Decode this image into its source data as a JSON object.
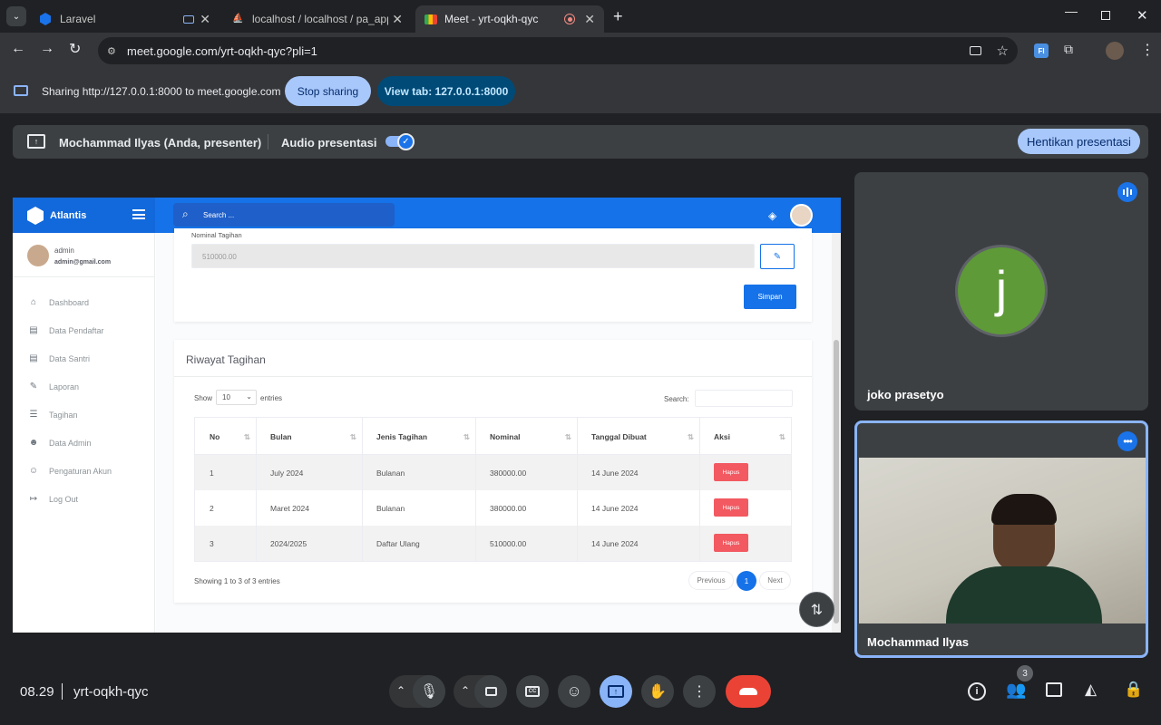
{
  "browser": {
    "tabs": [
      {
        "title": "Laravel"
      },
      {
        "title": "localhost / localhost / pa_apps"
      },
      {
        "title": "Meet - yrt-oqkh-qyc"
      }
    ],
    "url": "meet.google.com/yrt-oqkh-qyc?pli=1",
    "sharing_text": "Sharing http://127.0.0.1:8000 to meet.google.com",
    "stop_sharing": "Stop sharing",
    "view_tab": "View tab: 127.0.0.1:8000"
  },
  "meet": {
    "presenter": "Mochammad Ilyas (Anda, presenter)",
    "audio_label": "Audio presentasi",
    "stop_present": "Hentikan presentasi",
    "participants": [
      {
        "name": "joko prasetyo",
        "initial": "j"
      },
      {
        "name": "Mochammad Ilyas"
      }
    ],
    "time": "08.29",
    "meeting_code": "yrt-oqkh-qyc",
    "participant_count": "3",
    "colors": {
      "accent": "#8ab4f8",
      "end_call": "#ea4335",
      "avatar_green": "#5e9a37"
    }
  },
  "app": {
    "brand": "Atlantis",
    "search_placeholder": "Search ...",
    "user": {
      "name": "admin",
      "email": "admin@gmail.com"
    },
    "menu": [
      {
        "label": "Dashboard",
        "icon": "home-icon"
      },
      {
        "label": "Data Pendaftar",
        "icon": "id-card-icon"
      },
      {
        "label": "Data Santri",
        "icon": "id-card-icon"
      },
      {
        "label": "Laporan",
        "icon": "edit-icon"
      },
      {
        "label": "Tagihan",
        "icon": "database-icon"
      },
      {
        "label": "Data Admin",
        "icon": "users-icon"
      },
      {
        "label": "Pengaturan Akun",
        "icon": "user-cog-icon"
      },
      {
        "label": "Log Out",
        "icon": "sign-out-icon"
      }
    ],
    "form": {
      "label": "Nominal Tagihan",
      "value": "510000.00",
      "save": "Simpan"
    },
    "history": {
      "title": "Riwayat Tagihan",
      "show": "Show",
      "page_size": "10",
      "entries": "entries",
      "search_label": "Search:",
      "columns": [
        "No",
        "Bulan",
        "Jenis Tagihan",
        "Nominal",
        "Tanggal Dibuat",
        "Aksi"
      ],
      "rows": [
        {
          "no": "1",
          "bulan": "July 2024",
          "jenis": "Bulanan",
          "nominal": "380000.00",
          "tanggal": "14 June 2024",
          "aksi": "Hapus"
        },
        {
          "no": "2",
          "bulan": "Maret 2024",
          "jenis": "Bulanan",
          "nominal": "380000.00",
          "tanggal": "14 June 2024",
          "aksi": "Hapus"
        },
        {
          "no": "3",
          "bulan": "2024/2025",
          "jenis": "Daftar Ulang",
          "nominal": "510000.00",
          "tanggal": "14 June 2024",
          "aksi": "Hapus"
        }
      ],
      "info": "Showing 1 to 3 of 3 entries",
      "prev": "Previous",
      "page": "1",
      "next": "Next"
    },
    "colors": {
      "primary": "#1572e8",
      "danger": "#f25961"
    }
  }
}
